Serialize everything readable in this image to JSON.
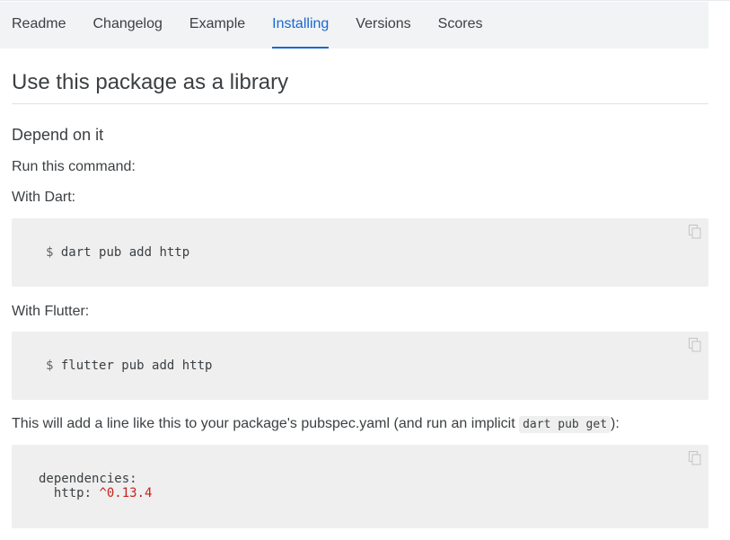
{
  "tabs": [
    {
      "label": "Readme"
    },
    {
      "label": "Changelog"
    },
    {
      "label": "Example"
    },
    {
      "label": "Installing",
      "active": true
    },
    {
      "label": "Versions"
    },
    {
      "label": "Scores"
    }
  ],
  "main": {
    "title": "Use this package as a library",
    "section_heading": "Depend on it",
    "run_command_text": "Run this command:",
    "with_dart_text": "With Dart:",
    "dart_command": {
      "prompt": "$",
      "command": "dart pub add http"
    },
    "with_flutter_text": "With Flutter:",
    "flutter_command": {
      "prompt": "$",
      "command": "flutter pub add http"
    },
    "pubspec_text_before": "This will add a line like this to your package's pubspec.yaml (and run an implicit ",
    "pubspec_inline_code": "dart pub get",
    "pubspec_text_after": "):",
    "yaml": {
      "line1": "dependencies:",
      "key": "  http: ",
      "version": "^0.13.4"
    }
  },
  "icons": {
    "copy": "copy-icon"
  },
  "colors": {
    "accent": "#1967d2",
    "tabbar_bg": "#f1f3f4",
    "code_bg": "#efefef",
    "version_red": "#c5221f"
  }
}
